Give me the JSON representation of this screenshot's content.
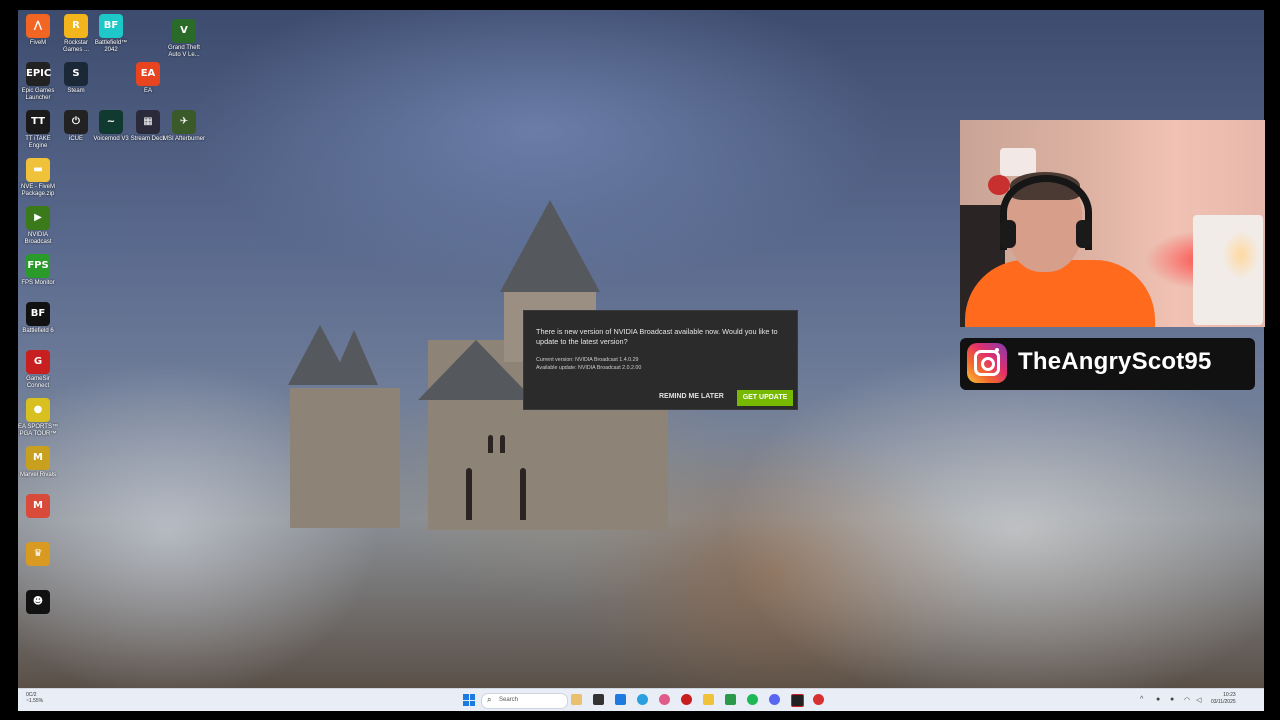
{
  "desktop": {
    "icons": [
      {
        "label": "FiveM",
        "glyph": "⋀",
        "color": "#f26522"
      },
      {
        "label": "Rockstar Games ...",
        "glyph": "R",
        "color": "#f2b51c"
      },
      {
        "label": "Battlefield™ 2042",
        "glyph": "BF",
        "color": "#1ec8c8"
      },
      {
        "label": "Grand Theft Auto V Le...",
        "glyph": "V",
        "color": "#2a6b2a"
      },
      {
        "label": "Epic Games Launcher",
        "glyph": "EPIC",
        "color": "#222"
      },
      {
        "label": "Steam",
        "glyph": "S",
        "color": "#1b2838"
      },
      {
        "label": "EA",
        "glyph": "EA",
        "color": "#e8441f"
      },
      {
        "label": "TT iTAKE Engine",
        "glyph": "TT",
        "color": "#1a1a1a"
      },
      {
        "label": "iCUE",
        "glyph": "⏻",
        "color": "#222"
      },
      {
        "label": "Voicemod V3",
        "glyph": "~",
        "color": "#103a30"
      },
      {
        "label": "Stream Deck",
        "glyph": "▦",
        "color": "#2a2a3a"
      },
      {
        "label": "MSI Afterburner",
        "glyph": "✈",
        "color": "#3a5a2a"
      },
      {
        "label": "NVE - FiveM Package.zip",
        "glyph": "▬",
        "color": "#f0c23a"
      },
      {
        "label": "NVIDIA Broadcast",
        "glyph": "▶",
        "color": "#3a7a1a"
      },
      {
        "label": "FPS Monitor",
        "glyph": "FPS",
        "color": "#2a9a2a"
      },
      {
        "label": "Battlefield 6",
        "glyph": "BF",
        "color": "#111"
      },
      {
        "label": "GameSir Connect",
        "glyph": "G",
        "color": "#c82020"
      },
      {
        "label": "EA SPORTS™ PGA TOUR™",
        "glyph": "●",
        "color": "#d8c020"
      },
      {
        "label": "Marvel Rivals",
        "glyph": "M",
        "color": "#c8a020"
      },
      {
        "label": "",
        "glyph": "M",
        "color": "#d84a3a"
      },
      {
        "label": "",
        "glyph": "♛",
        "color": "#d89a20"
      },
      {
        "label": "",
        "glyph": "☻",
        "color": "#111"
      }
    ]
  },
  "dialog": {
    "message": "There is new version of NVIDIA Broadcast available now. Would you like to update to the latest version?",
    "current_version": "Current version: NVIDIA Broadcast 1.4.0.29",
    "available_update": "Available update: NVIDIA Broadcast 2.0.2.00",
    "remind_label": "REMIND ME LATER",
    "update_label": "GET UPDATE",
    "accent": "#76b900"
  },
  "overlay": {
    "instagram_handle": "TheAngryScot95"
  },
  "taskbar": {
    "weather_temp": "0C/2",
    "weather_note": "~1.55%",
    "search_placeholder": "Search",
    "time": "10:23",
    "date": "03/11/2025"
  }
}
